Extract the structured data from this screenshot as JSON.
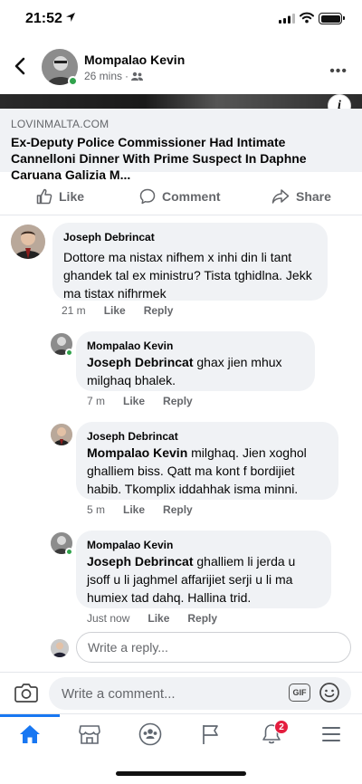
{
  "status_bar": {
    "time": "21:52"
  },
  "header": {
    "author": "Mompalao Kevin",
    "time_ago": "26 mins",
    "separator": "·",
    "audience_icon": "friends-icon"
  },
  "link": {
    "domain": "LOVINMALTA.COM",
    "title": "Ex-Deputy Police Commissioner Had Intimate Cannelloni Dinner With Prime Suspect In Daphne Caruana Galizia M..."
  },
  "actions": {
    "like": "Like",
    "comment": "Comment",
    "share": "Share"
  },
  "comments": [
    {
      "author": "Joseph Debrincat",
      "mention": "",
      "text": "Dottore ma nistax nifhem x inhi din li tant ghandek tal ex ministru? Tista tghidlna. Jekk ma tistax nifhrmek",
      "time": "21 m",
      "like": "Like",
      "reply": "Reply"
    },
    {
      "author": "Mompalao Kevin",
      "mention": "Joseph Debrincat",
      "text": " ghax jien mhux milghaq bhalek.",
      "time": "7 m",
      "like": "Like",
      "reply": "Reply"
    },
    {
      "author": "Joseph Debrincat",
      "mention": "Mompalao Kevin",
      "text": " milghaq. Jien xoghol ghalliem biss. Qatt ma kont f bordijiet habib. Tkomplix iddahhak isma minni.",
      "time": "5 m",
      "like": "Like",
      "reply": "Reply"
    },
    {
      "author": "Mompalao Kevin",
      "mention": "Joseph Debrincat",
      "text": "  ghalliem li jerda u jsoff u li jaghmel affarijiet serji u li ma humiex tad dahq. Hallina trid.",
      "time": "Just now",
      "like": "Like",
      "reply": "Reply"
    }
  ],
  "reply_box": {
    "placeholder": "Write a reply..."
  },
  "composer": {
    "placeholder": "Write a comment...",
    "gif": "GIF"
  },
  "tabbar": {
    "items": [
      "home-icon",
      "marketplace-icon",
      "groups-icon",
      "pages-flag-icon",
      "notifications-icon",
      "menu-icon"
    ],
    "notification_count": "2",
    "active_color": "#1877f2"
  }
}
